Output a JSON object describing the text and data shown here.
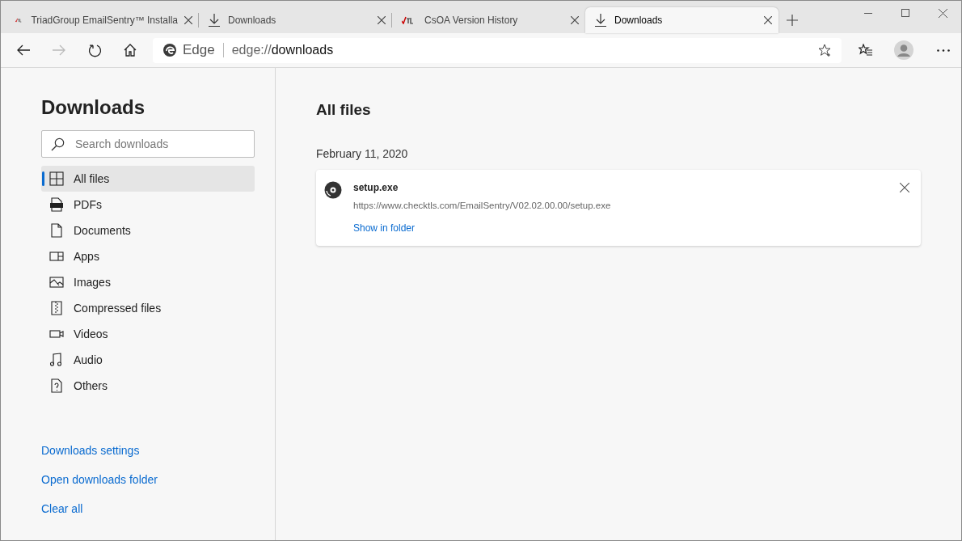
{
  "tabs": [
    {
      "kind": "logo",
      "title": "TriadGroup EmailSentry™ Installa",
      "selected": false
    },
    {
      "kind": "download",
      "title": "Downloads",
      "selected": false
    },
    {
      "kind": "logo",
      "title": "CsOA Version History",
      "selected": false
    },
    {
      "kind": "download",
      "title": "Downloads",
      "selected": true
    }
  ],
  "address_bar": {
    "site_label": "Edge",
    "url_prefix": "edge://",
    "url_path": "downloads"
  },
  "sidebar": {
    "title": "Downloads",
    "search": {
      "placeholder": "Search downloads"
    },
    "items": [
      {
        "kind": "all",
        "label": "All files",
        "selected": true
      },
      {
        "kind": "pdf",
        "label": "PDFs",
        "selected": false
      },
      {
        "kind": "doc",
        "label": "Documents",
        "selected": false
      },
      {
        "kind": "app",
        "label": "Apps",
        "selected": false
      },
      {
        "kind": "image",
        "label": "Images",
        "selected": false
      },
      {
        "kind": "zip",
        "label": "Compressed files",
        "selected": false
      },
      {
        "kind": "video",
        "label": "Videos",
        "selected": false
      },
      {
        "kind": "audio",
        "label": "Audio",
        "selected": false
      },
      {
        "kind": "other",
        "label": "Others",
        "selected": false
      }
    ],
    "links": [
      "Downloads settings",
      "Open downloads folder",
      "Clear all"
    ]
  },
  "main": {
    "title": "All files",
    "groups": [
      {
        "date": "February 11, 2020",
        "downloads": [
          {
            "name": "setup.exe",
            "url": "https://www.checktls.com/EmailSentry/V02.02.00.00/setup.exe",
            "action": "Show in folder"
          }
        ]
      }
    ]
  }
}
